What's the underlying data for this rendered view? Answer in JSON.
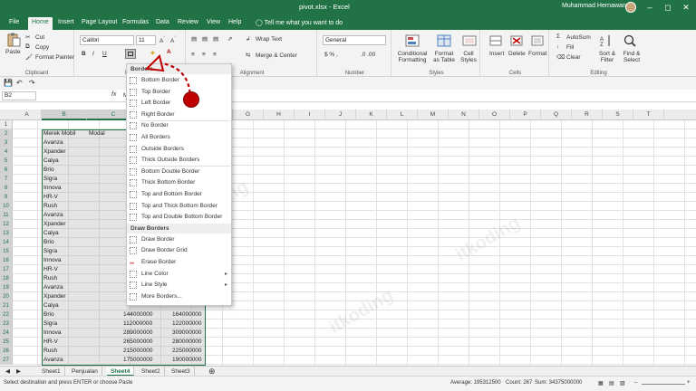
{
  "window": {
    "title": "pivot.xlsx  -  Excel",
    "user": "Muhammad Hernawan"
  },
  "tabs": [
    "File",
    "Home",
    "Insert",
    "Page Layout",
    "Formulas",
    "Data",
    "Review",
    "View",
    "Help"
  ],
  "tellme": "Tell me what you want to do",
  "ribbon": {
    "clipboard": {
      "paste": "Paste",
      "cut": "Cut",
      "copy": "Copy",
      "format_painter": "Format Painter",
      "label": "Clipboard"
    },
    "font": {
      "name": "Calibri",
      "size": "11",
      "label": "Font"
    },
    "alignment": {
      "wrap": "Wrap Text",
      "merge": "Merge & Center",
      "label": "Alignment"
    },
    "number": {
      "format": "General",
      "label": "Number"
    },
    "styles": {
      "conditional": "Conditional Formatting",
      "format_table": "Format as Table",
      "cell_styles": "Cell Styles",
      "label": "Styles"
    },
    "cells": {
      "insert": "Insert",
      "delete": "Delete",
      "format": "Format",
      "label": "Cells"
    },
    "editing": {
      "autosum": "AutoSum",
      "fill": "Fill",
      "clear": "Clear",
      "sort": "Sort & Filter",
      "find": "Find & Select",
      "label": "Editing"
    }
  },
  "formula_bar": {
    "namebox": "B2",
    "fx": "fx",
    "content": "M"
  },
  "columns": [
    "A",
    "B",
    "C",
    "D",
    "E",
    "F",
    "G",
    "H",
    "I",
    "J",
    "K",
    "L",
    "M",
    "N",
    "O",
    "P",
    "Q",
    "R",
    "S",
    "T"
  ],
  "rows": [
    "1",
    "2",
    "3",
    "4",
    "5",
    "6",
    "7",
    "8",
    "9",
    "10",
    "11",
    "12",
    "13",
    "14",
    "15",
    "16",
    "17",
    "18",
    "19",
    "20",
    "21",
    "22",
    "23",
    "24",
    "25",
    "26",
    "27"
  ],
  "table": {
    "header": [
      "Merek Mobil",
      "Modal"
    ],
    "col_b": [
      "Avanza",
      "Xpander",
      "Calya",
      "Brio",
      "Sigra",
      "Innova",
      "HR-V",
      "Rush",
      "Avanza",
      "Xpander",
      "Calya",
      "Brio",
      "Sigra",
      "Innova",
      "HR-V",
      "Rush",
      "Avanza",
      "Xpander",
      "Calya",
      "Brio",
      "Sigra",
      "Innova",
      "HR-V",
      "Rush",
      "Avanza"
    ],
    "visible_values": [
      [
        "144000000",
        "164000000"
      ],
      [
        "112000000",
        "122000000"
      ],
      [
        "289000000",
        "309000000"
      ],
      [
        "265000000",
        "280000000"
      ],
      [
        "215000000",
        "225000000"
      ],
      [
        "175000000",
        "190000000"
      ]
    ]
  },
  "borders_menu": {
    "header": "Borders",
    "items": [
      "Bottom Border",
      "Top Border",
      "Left Border",
      "Right Border",
      "No Border",
      "All Borders",
      "Outside Borders",
      "Thick Outside Borders",
      "Bottom Double Border",
      "Thick Bottom Border",
      "Top and Bottom Border",
      "Top and Thick Bottom Border",
      "Top and Double Bottom Border"
    ],
    "draw_header": "Draw Borders",
    "draw_items": [
      "Draw Border",
      "Draw Border Grid",
      "Erase Border",
      "Line Color",
      "Line Style",
      "More Borders..."
    ]
  },
  "sheets": [
    "Sheet1",
    "Penjualan",
    "Sheet4",
    "Sheet2",
    "Sheet3"
  ],
  "active_sheet": "Sheet4",
  "status": {
    "message": "Select destination and press ENTER or choose Paste",
    "average": "Average: 195312500",
    "count": "Count: 267",
    "sum": "Sum: 34375000000"
  },
  "watermark": "itkoding",
  "colors": {
    "excel_green": "#217346",
    "annotation_red": "#c00000"
  }
}
